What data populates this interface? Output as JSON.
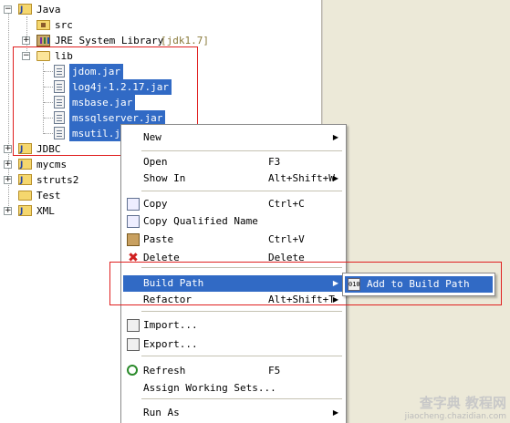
{
  "tree": {
    "java_project": "Java",
    "src": "src",
    "jre": "JRE System Library",
    "jre_version": "[jdk1.7]",
    "lib": "lib",
    "jars": [
      "jdom.jar",
      "log4j-1.2.17.jar",
      "msbase.jar",
      "mssqlserver.jar",
      "msutil.jar"
    ],
    "projects": [
      "JDBC",
      "mycms",
      "struts2",
      "Test",
      "XML"
    ]
  },
  "context_menu": {
    "new": "New",
    "open": "Open",
    "open_shortcut": "F3",
    "show_in": "Show In",
    "show_in_shortcut": "Alt+Shift+W",
    "copy": "Copy",
    "copy_shortcut": "Ctrl+C",
    "copy_qualified": "Copy Qualified Name",
    "paste": "Paste",
    "paste_shortcut": "Ctrl+V",
    "delete": "Delete",
    "delete_shortcut": "Delete",
    "build_path": "Build Path",
    "refactor": "Refactor",
    "refactor_shortcut": "Alt+Shift+T",
    "import": "Import...",
    "export": "Export...",
    "refresh": "Refresh",
    "refresh_shortcut": "F5",
    "assign_working_sets": "Assign Working Sets...",
    "run_as": "Run As"
  },
  "submenu": {
    "add_to_build_path": "Add to Build Path",
    "add_icon_text": "010"
  },
  "watermark": {
    "line1": "查字典 教程网",
    "line2": "jiaocheng.chazidian.com"
  },
  "colors": {
    "selection": "#316ac5",
    "highlight_box": "#e02020"
  }
}
